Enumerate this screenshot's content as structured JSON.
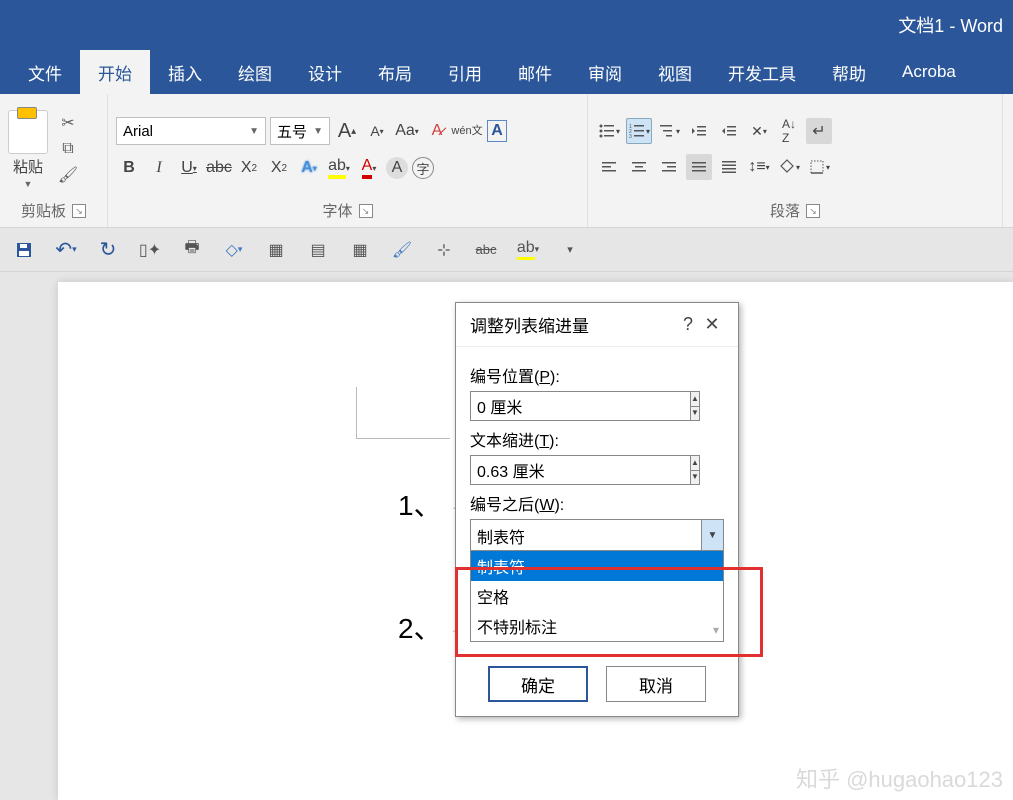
{
  "title": "文档1  -  Word",
  "tabs": [
    "文件",
    "开始",
    "插入",
    "绘图",
    "设计",
    "布局",
    "引用",
    "邮件",
    "审阅",
    "视图",
    "开发工具",
    "帮助",
    "Acroba"
  ],
  "active_tab": 1,
  "clipboard": {
    "paste": "粘贴",
    "group_label": "剪贴板"
  },
  "font": {
    "group_label": "字体",
    "name": "Arial",
    "size": "五号"
  },
  "paragraph": {
    "group_label": "段落"
  },
  "doc": {
    "items": [
      "1、",
      "2、"
    ]
  },
  "dialog": {
    "title": "调整列表缩进量",
    "number_position_label": "编号位置(P):",
    "number_position_value": "0 厘米",
    "text_indent_label": "文本缩进(T):",
    "text_indent_value": "0.63 厘米",
    "after_number_label": "编号之后(W):",
    "after_number_value": "制表符",
    "options": [
      "制表符",
      "空格",
      "不特别标注"
    ],
    "ok": "确定",
    "cancel": "取消"
  },
  "watermark": "知乎 @hugaohao123"
}
